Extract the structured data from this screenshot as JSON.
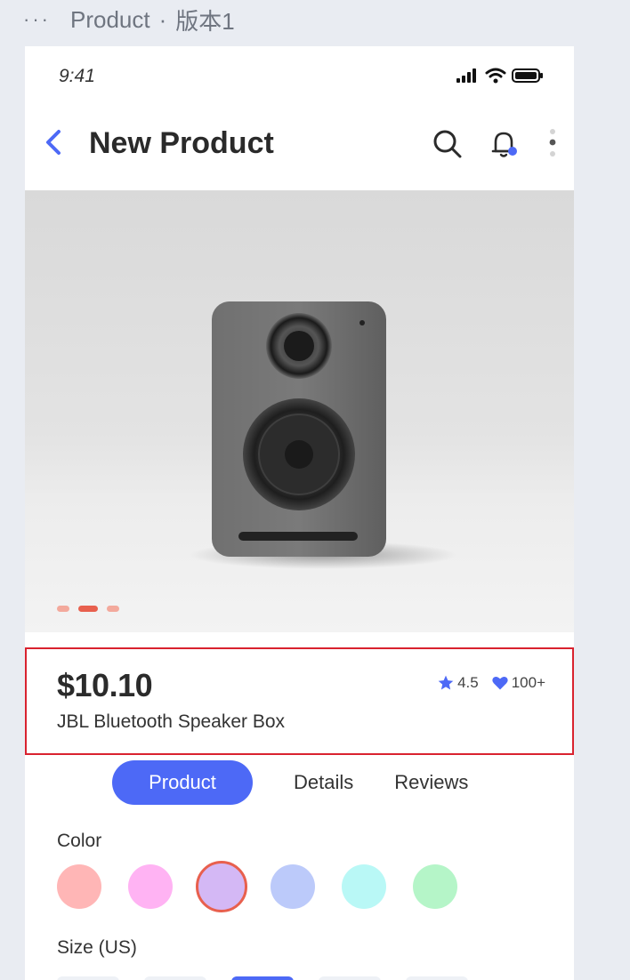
{
  "editor": {
    "dots": "···",
    "page_name": "Product",
    "separator": "·",
    "version": "版本1"
  },
  "status_bar": {
    "time": "9:41"
  },
  "nav": {
    "title": "New Product",
    "accent_color": "#4d69f6"
  },
  "hero": {
    "image_alt": "speaker",
    "slide_count": 3,
    "active_slide": 2
  },
  "product": {
    "price": "$10.10",
    "name": "JBL Bluetooth Speaker Box",
    "rating": "4.5",
    "likes": "100+"
  },
  "tabs": [
    {
      "label": "Product",
      "active": true
    },
    {
      "label": "Details",
      "active": false
    },
    {
      "label": "Reviews",
      "active": false
    }
  ],
  "color_section": {
    "label": "Color",
    "swatches": [
      "#ffb6b6",
      "#ffb3f3",
      "#d4b8f5",
      "#bccafa",
      "#b9f8f6",
      "#b5f5c8"
    ],
    "selected_index": 2,
    "selected_ring_color": "#e8604e"
  },
  "size_section": {
    "label": "Size (US)"
  }
}
